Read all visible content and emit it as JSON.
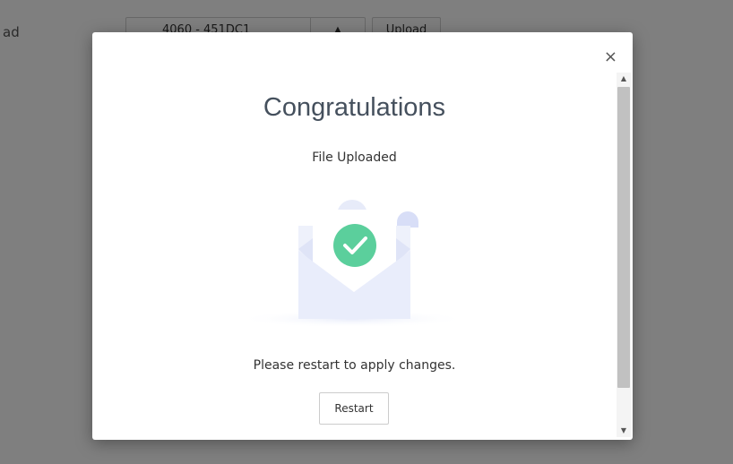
{
  "background": {
    "upload_label": "ad",
    "file_select_value": "4060 - 451DC1",
    "upload_button_label": "Upload"
  },
  "modal": {
    "close_label": "×",
    "title": "Congratulations",
    "subtitle": "File Uploaded",
    "message": "Please restart to apply changes.",
    "restart_button_label": "Restart",
    "illustration_icon": "envelope-check-icon",
    "accent_color": "#5bcf9c"
  }
}
